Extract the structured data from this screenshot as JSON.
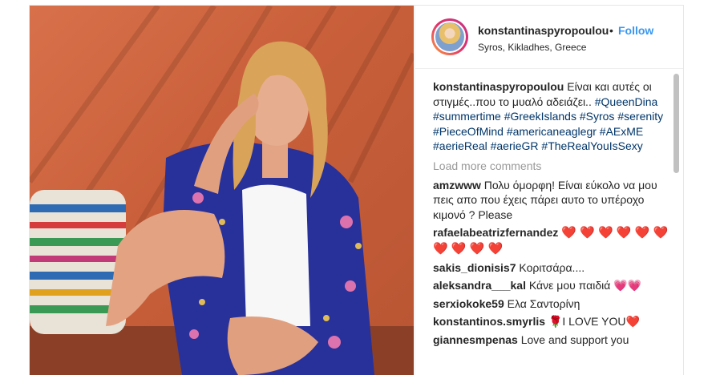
{
  "post": {
    "username": "konstantinaspyropoulou",
    "dot": "•",
    "follow_label": "Follow",
    "location": "Syros, Kikladhes, Greece"
  },
  "caption": {
    "username": "konstantinaspyropoulou",
    "text": "Είναι και αυτές οι στιγμές..που το μυαλό αδειάζει..",
    "hashtags": [
      "#QueenDina",
      "#summertime",
      "#GreekIslands",
      "#Syros",
      "#serenity",
      "#PieceOfMind",
      "#americaneaglegr",
      "#AExME",
      "#aerieReal",
      "#aerieGR",
      "#TheRealYouIsSexy"
    ]
  },
  "load_more": "Load more comments",
  "comments": [
    {
      "user": "amzwww",
      "text": "Πολυ όμορφη! Είναι εύκολο να μου πεις απο που έχεις πάρει αυτο το υπέροχο κιμονό ? Please"
    },
    {
      "user": "rafaelabeatrizfernandez",
      "text": "❤️ ❤️ ❤️ ❤️ ❤️ ❤️ ❤️ ❤️ ❤️ ❤️"
    },
    {
      "user": "sakis_dionisis7",
      "text": "Κοριτσάρα...."
    },
    {
      "user": "aleksandra___kal",
      "text": "Κάνε μου παιδιά 💗💗"
    },
    {
      "user": "serxiokoke59",
      "text": "Ελα Σαντορίνη"
    },
    {
      "user": "konstantinos.smyrlis",
      "text": "🌹I LOVE YOU❤️"
    },
    {
      "user": "giannesmpenas",
      "text": "Love and support you"
    }
  ],
  "colors": {
    "link": "#3897f0",
    "hashtag": "#003569",
    "muted": "#999999",
    "text": "#262626"
  }
}
